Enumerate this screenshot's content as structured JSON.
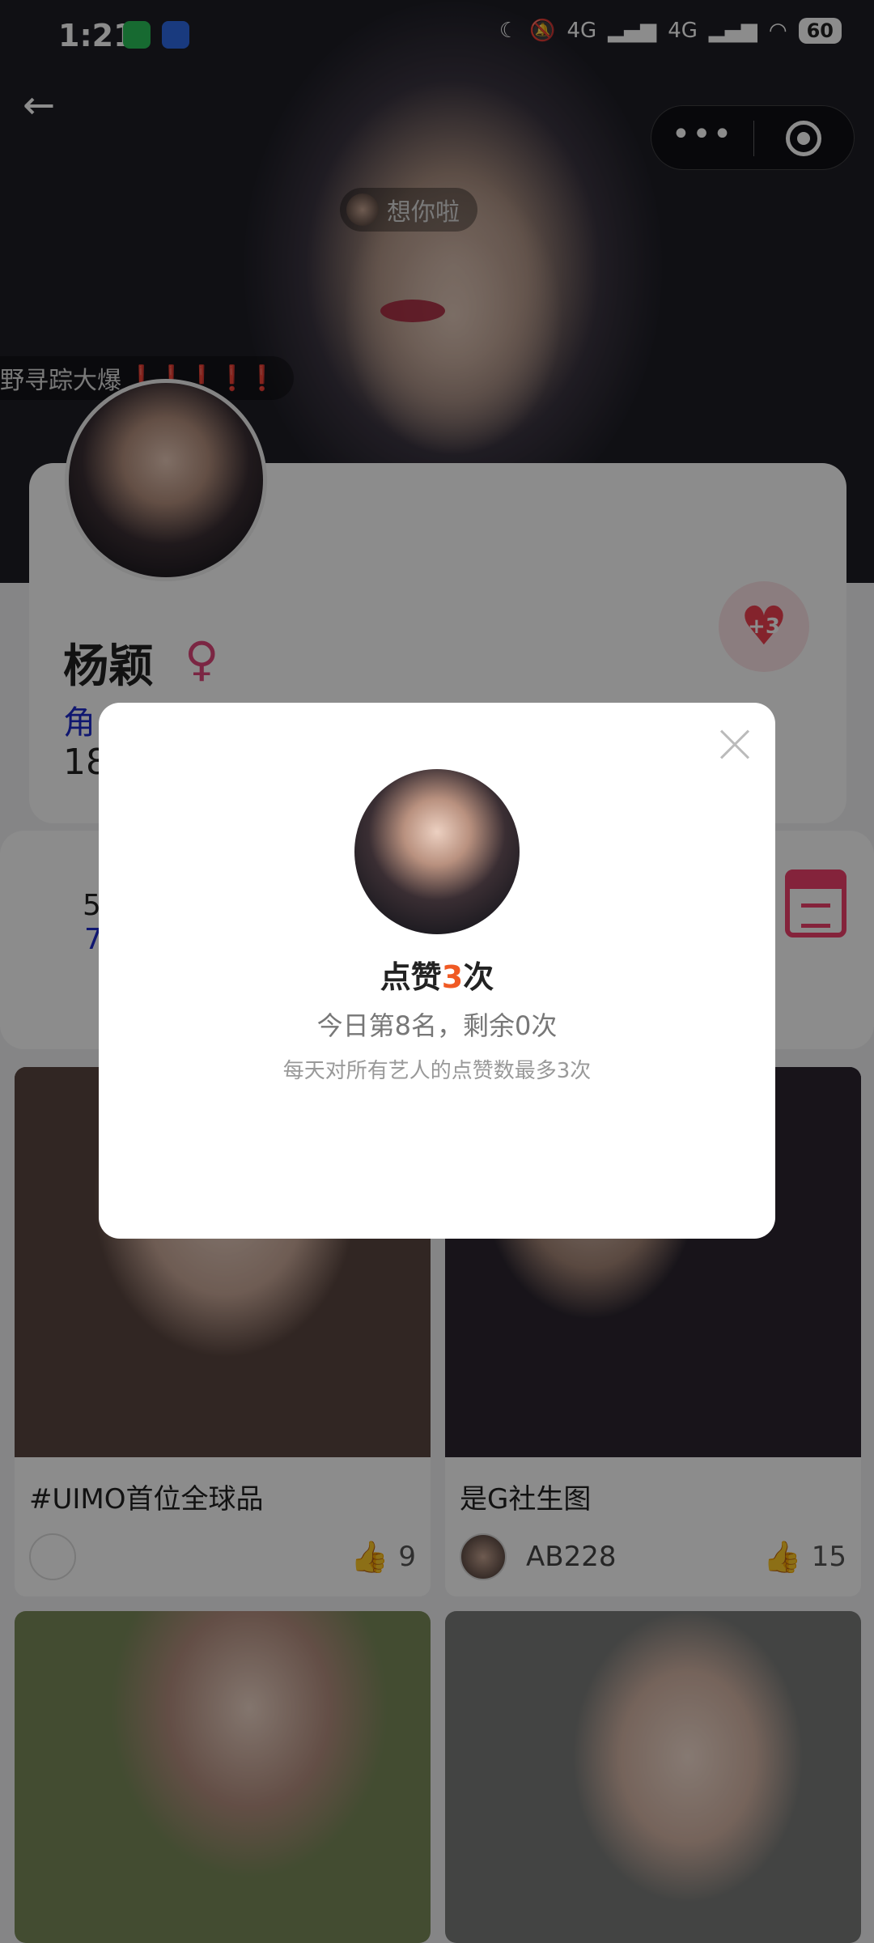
{
  "status_bar": {
    "time": "1:21",
    "network_1": "4G",
    "network_2": "4G",
    "battery": "60"
  },
  "nav": {
    "back": "←",
    "more": "•••"
  },
  "danmaku": {
    "first": "想你啦",
    "second": "野寻踪大爆",
    "second_marks": "❗❗❗❗❗"
  },
  "profile": {
    "name": "杨颖",
    "gender_symbol": "♀",
    "role_label": "角",
    "number_partial": "18",
    "like_bonus": "+3"
  },
  "stats": {
    "row1": "5",
    "row2": "7"
  },
  "posts": [
    {
      "title": "#UIMO首位全球品",
      "author": "",
      "likes": "9"
    },
    {
      "title": "是G社生图",
      "author": "AB228",
      "likes": "15"
    }
  ],
  "modal": {
    "title_prefix": "点赞",
    "title_count": "3",
    "title_suffix": "次",
    "rank_line": "今日第8名，剩余0次",
    "rule_line": "每天对所有艺人的点赞数最多3次"
  },
  "colors": {
    "accent_orange": "#f05a24",
    "heart_red": "#f04050",
    "link_blue": "#1e2acc",
    "calendar_pink": "#f0406c"
  }
}
